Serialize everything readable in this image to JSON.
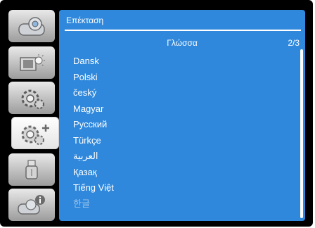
{
  "sidebar": {
    "items": [
      {
        "icon": "projector-icon"
      },
      {
        "icon": "image-adjust-icon"
      },
      {
        "icon": "settings-gear-icon"
      },
      {
        "icon": "expansion-gear-plus-icon"
      },
      {
        "icon": "usb-icon"
      },
      {
        "icon": "projector-info-icon"
      }
    ],
    "active_index": 3
  },
  "panel": {
    "title": "Επέκταση",
    "header": "Γλώσσα",
    "page": "2/3"
  },
  "languages": [
    {
      "label": "Dansk"
    },
    {
      "label": "Polski"
    },
    {
      "label": "český"
    },
    {
      "label": "Magyar"
    },
    {
      "label": "Русский"
    },
    {
      "label": "Türkçe"
    },
    {
      "label": "العربية"
    },
    {
      "label": "Қазақ"
    },
    {
      "label": "Tiếng Việt"
    },
    {
      "label": "한글"
    }
  ],
  "colors": {
    "panel_bg": "#2f88dc",
    "frame_bg": "#000000",
    "text": "#ffffff",
    "dim_text": "#9ac3ec"
  }
}
